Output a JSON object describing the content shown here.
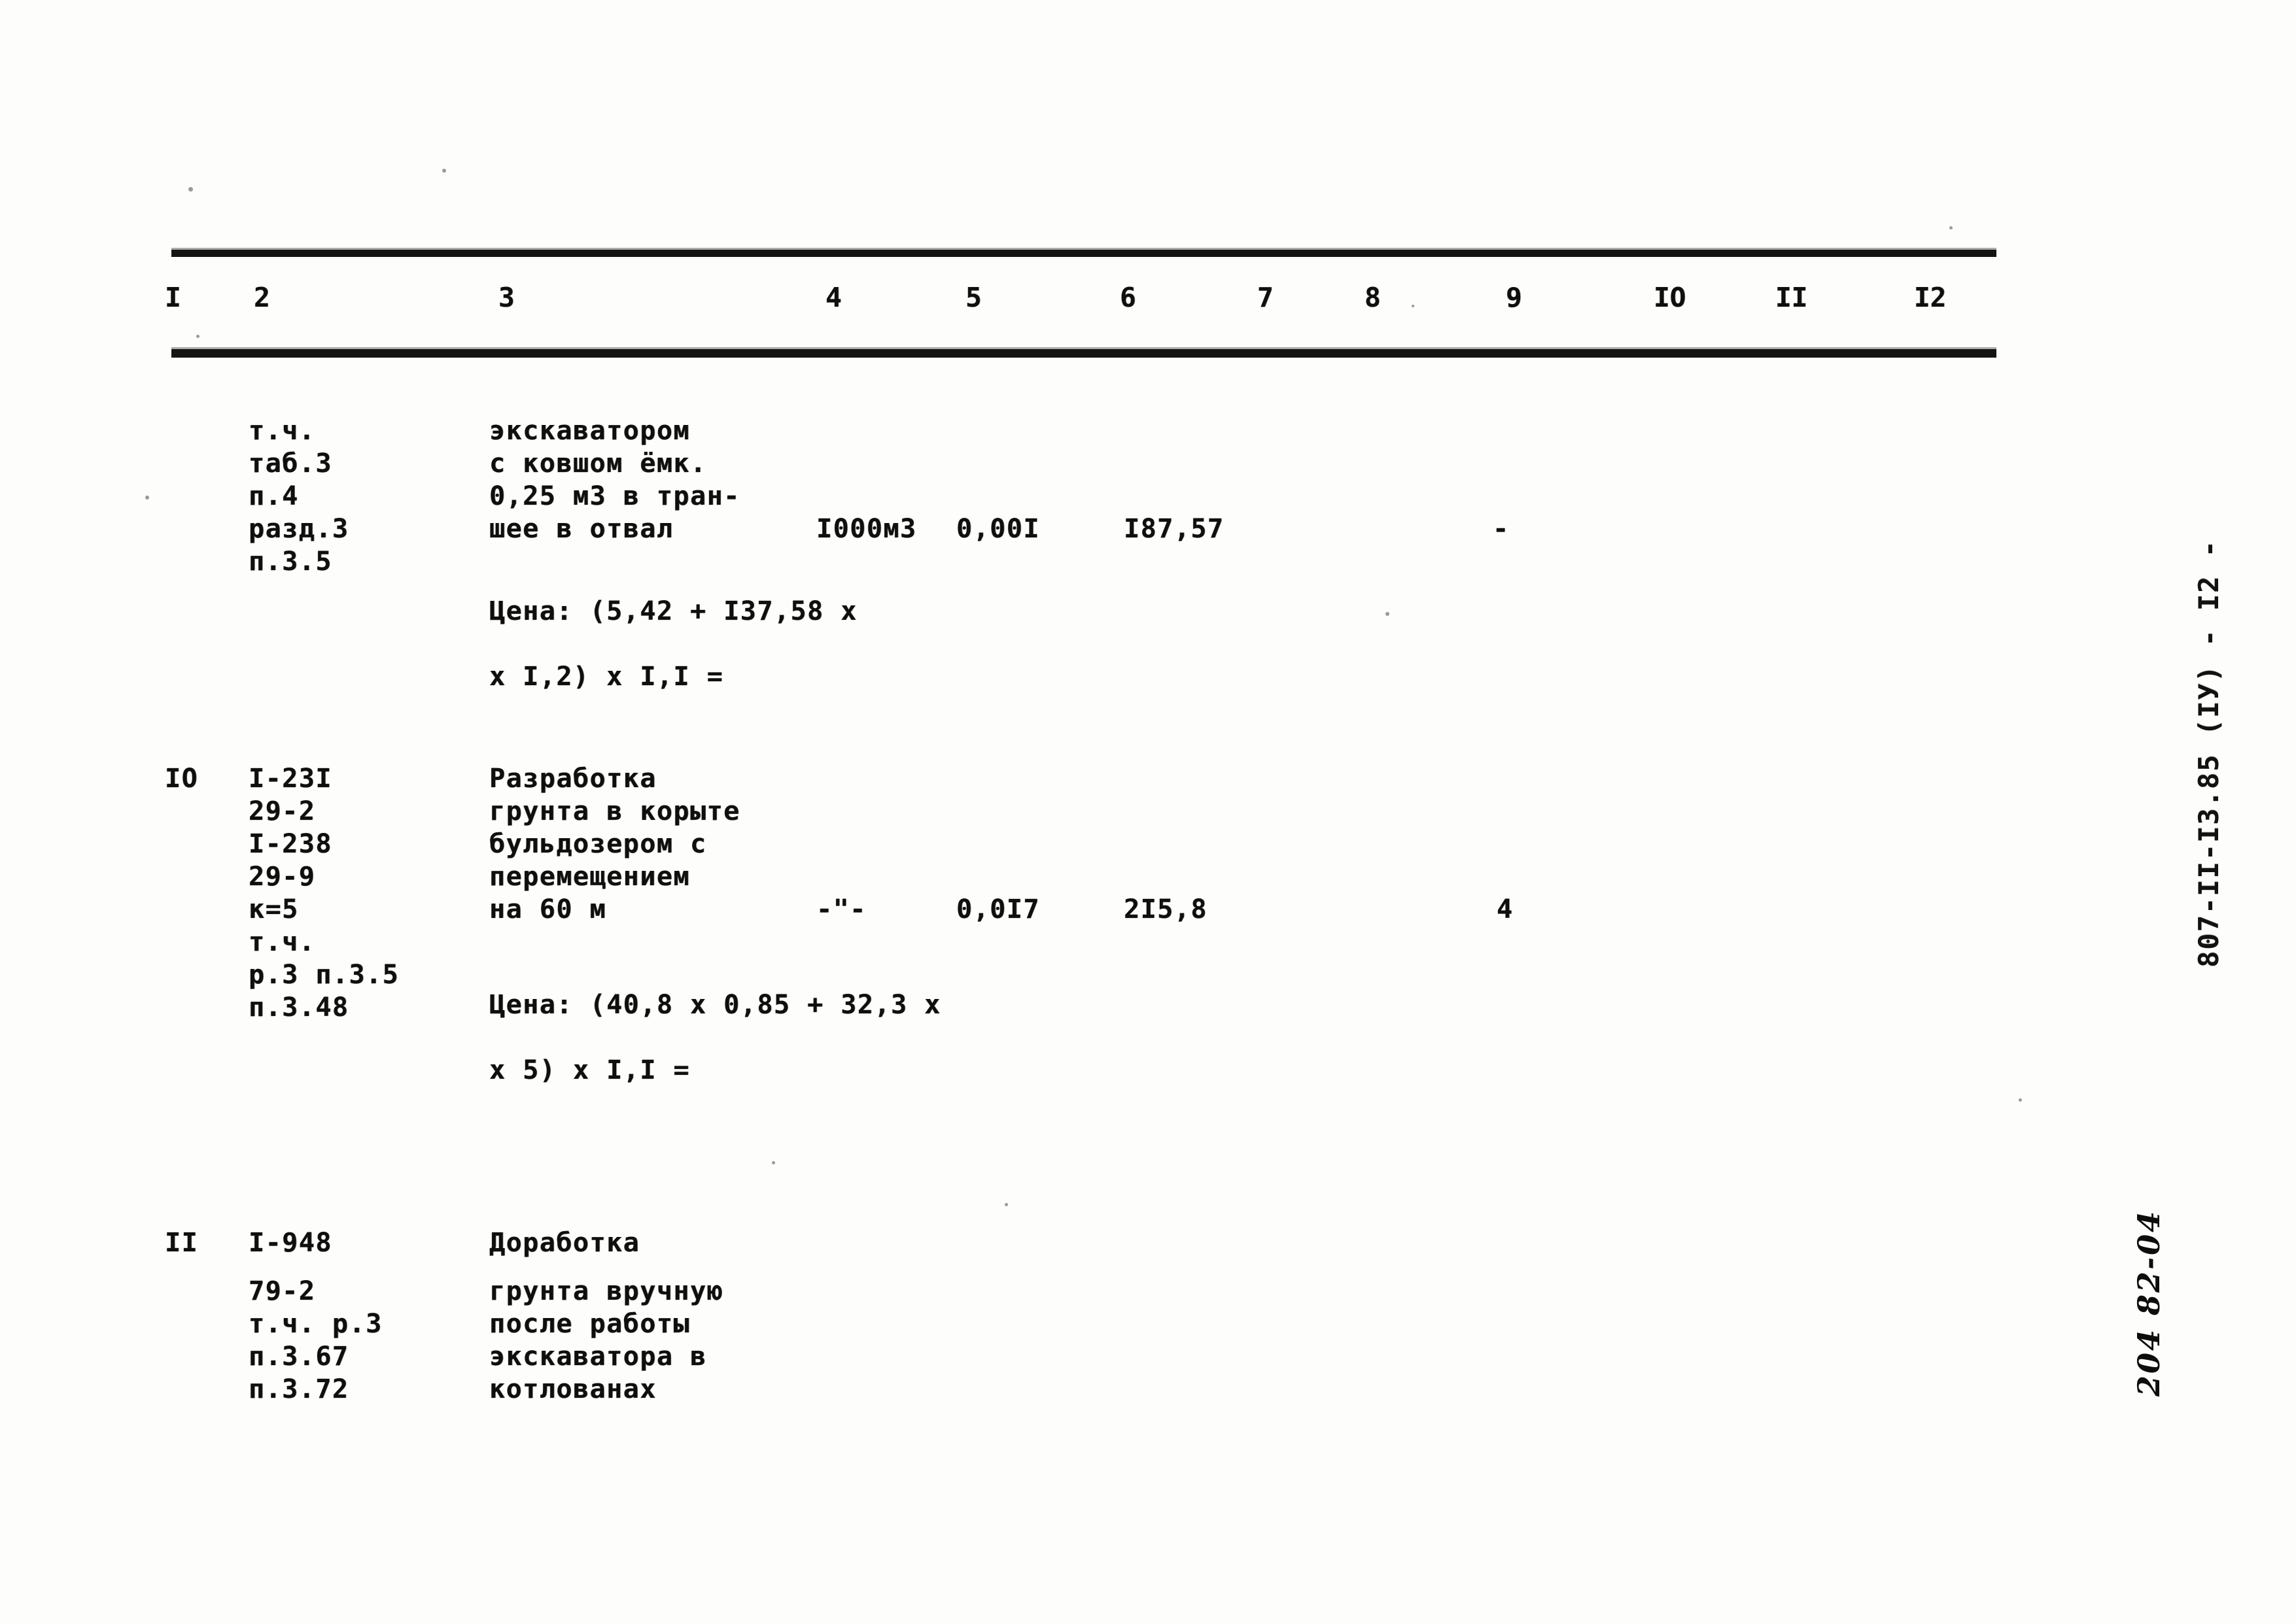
{
  "document": {
    "type": "scanned-technical-estimate-table",
    "page_margin_code": "807-II-I3.85 (IУ)  -  I2 -",
    "page_margin_handwritten": "204 82-04"
  },
  "table": {
    "column_headers": [
      "I",
      "2",
      "3",
      "4",
      "5",
      "6",
      "7",
      "8",
      "9",
      "IO",
      "II",
      "I2"
    ],
    "rows": [
      {
        "no": "",
        "col2_lines": [
          "т.ч.",
          "таб.3",
          "п.4",
          "разд.3",
          "п.3.5"
        ],
        "col3_lines": [
          "экскаватором",
          "с ковшом ёмк.",
          "0,25 м3 в тран-",
          "шее в отвал"
        ],
        "unit": "I000м3",
        "qty": "0,00I",
        "price": "I87,57",
        "col9": "-",
        "formula_line1": "Цена: (5,42 + I37,58 х",
        "formula_line2": "х I,2) х I,I ="
      },
      {
        "no": "IO",
        "col2_lines": [
          "I-23I",
          "29-2",
          "I-238",
          "29-9",
          "к=5",
          "т.ч.",
          "р.3 п.3.5",
          "п.3.48"
        ],
        "col3_lines": [
          "Разработка",
          "грунта в корыте",
          "бульдозером с",
          "перемещением",
          "на 60 м"
        ],
        "unit": "-\"-",
        "qty": "0,0I7",
        "price": "2I5,8",
        "col9": "4",
        "formula_line1": "Цена: (40,8 х 0,85 + 32,3 х",
        "formula_line2": "х 5) х I,I ="
      },
      {
        "no": "II",
        "col2_lines": [
          "I-948",
          "79-2",
          "т.ч. р.3",
          "п.3.67",
          "п.3.72"
        ],
        "col3_lines": [
          "Доработка",
          "грунта вручную",
          "после работы",
          "экскаватора в",
          "котлованах"
        ],
        "unit": "",
        "qty": "",
        "price": "",
        "col9": "",
        "formula_line1": "",
        "formula_line2": ""
      }
    ]
  },
  "colors": {
    "paper": "#fdfdfb",
    "ink": "#100f0d",
    "rule": "#141414"
  }
}
